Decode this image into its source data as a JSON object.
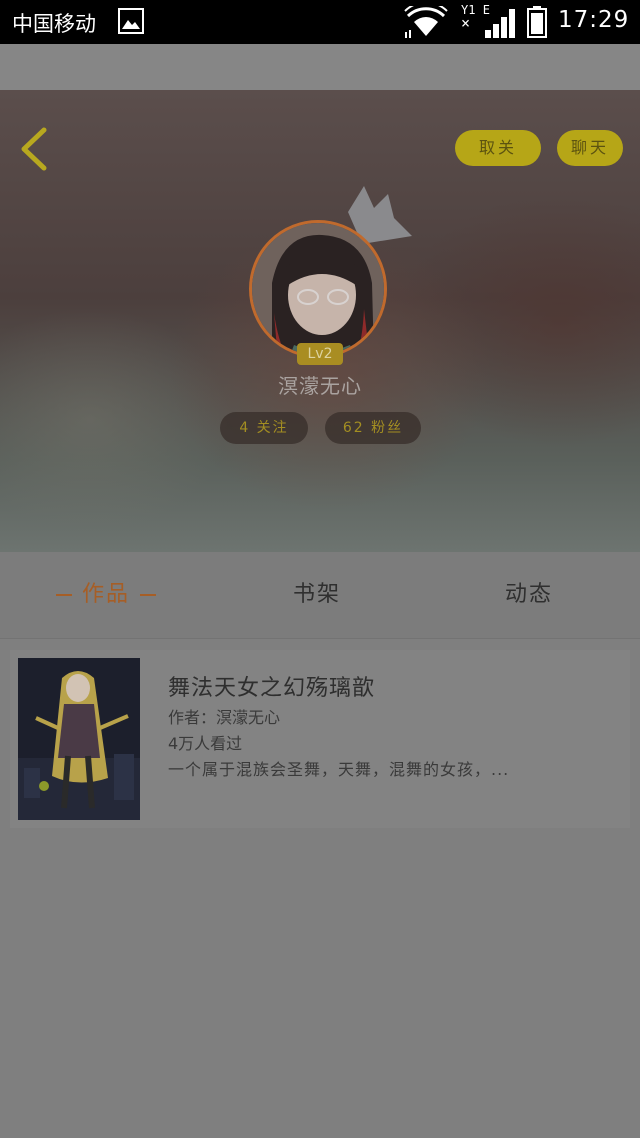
{
  "status_bar": {
    "carrier": "中国移动",
    "signal_label_top": "Y1",
    "signal_label_e": "E",
    "signal_label_x": "×",
    "time": "17:29"
  },
  "profile": {
    "unfollow_label": "取关",
    "chat_label": "聊天",
    "level": "Lv2",
    "username": "溟濛无心",
    "following": "4 关注",
    "followers": "62 粉丝"
  },
  "tabs": [
    {
      "label": "作品",
      "active": true
    },
    {
      "label": "书架",
      "active": false
    },
    {
      "label": "动态",
      "active": false
    }
  ],
  "books": [
    {
      "title": "舞法天女之幻殇璃歆",
      "author": "作者：溟濛无心",
      "views": "4万人看过",
      "description": "一个属于混族会圣舞，天舞，混舞的女孩，..."
    }
  ],
  "colors": {
    "accent": "#b6a617",
    "tab_active": "#a65e26",
    "avatar_ring": "#c06a2d"
  },
  "icons": [
    "image-icon",
    "wifi-icon",
    "signal-icon",
    "battery-icon",
    "back-arrow-icon",
    "crown-icon"
  ]
}
